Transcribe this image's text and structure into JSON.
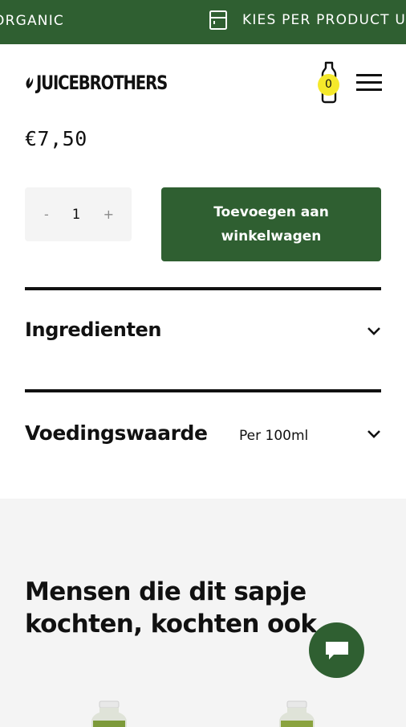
{
  "promo": {
    "left_text": "ORGANIC",
    "right_text": "KIES PER PRODUCT U"
  },
  "header": {
    "logo_text": "JUICEBROTHERS",
    "cart_count": "0"
  },
  "product": {
    "price": "€7,50",
    "quantity": "1",
    "minus_label": "-",
    "plus_label": "+",
    "add_to_cart_label": "Toevoegen aan winkelwagen"
  },
  "accordions": [
    {
      "title": "Ingredienten",
      "subtitle": ""
    },
    {
      "title": "Voedingswaarde",
      "subtitle": "Per 100ml"
    }
  ],
  "related": {
    "title": "Mensen die dit sapje kochten, kochten ook"
  },
  "colors": {
    "brand_green": "#2f5f31",
    "cart_badge": "#f5e92b",
    "section_bg": "#f4f4f4"
  },
  "icons": {
    "promo": "cabinet-icon",
    "cart": "bottle-icon",
    "menu": "hamburger-icon",
    "accordion": "chevron-down-icon",
    "chat": "chat-icon"
  }
}
